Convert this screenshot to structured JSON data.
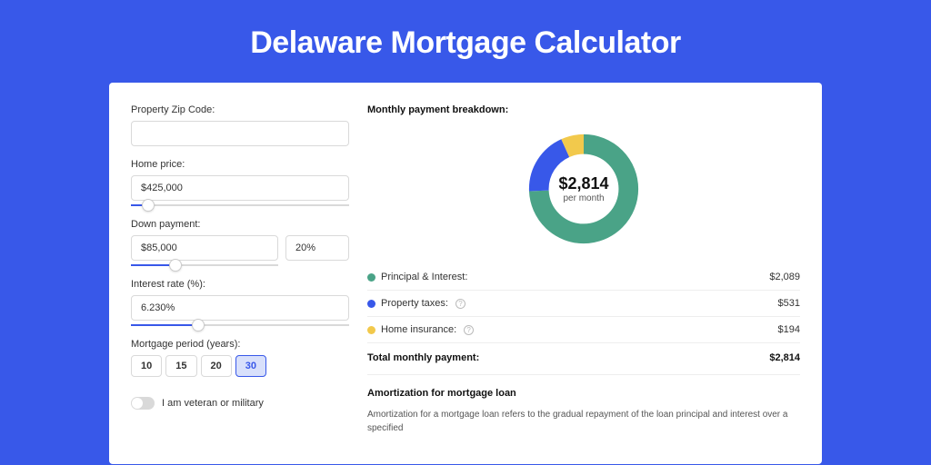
{
  "title": "Delaware Mortgage Calculator",
  "form": {
    "zip_label": "Property Zip Code:",
    "zip_value": "",
    "home_price_label": "Home price:",
    "home_price_value": "$425,000",
    "home_price_slider_pct": 8,
    "down_payment_label": "Down payment:",
    "down_payment_amount": "$85,000",
    "down_payment_pct": "20%",
    "down_payment_slider_pct": 20,
    "interest_label": "Interest rate (%):",
    "interest_value": "6.230%",
    "interest_slider_pct": 31,
    "period_label": "Mortgage period (years):",
    "period_options": [
      "10",
      "15",
      "20",
      "30"
    ],
    "period_active": "30",
    "veteran_label": "I am veteran or military",
    "veteran_on": false
  },
  "breakdown": {
    "title": "Monthly payment breakdown:",
    "total_display": "$2,814",
    "per_month_label": "per month",
    "items": [
      {
        "color": "green",
        "label": "Principal & Interest:",
        "value": "$2,089",
        "help": false
      },
      {
        "color": "blue",
        "label": "Property taxes:",
        "value": "$531",
        "help": true
      },
      {
        "color": "yellow",
        "label": "Home insurance:",
        "value": "$194",
        "help": true
      }
    ],
    "total_label": "Total monthly payment:",
    "total_value": "$2,814"
  },
  "chart_data": {
    "type": "pie",
    "title": "Monthly payment breakdown",
    "series": [
      {
        "name": "Principal & Interest",
        "value": 2089,
        "color": "#4aa387"
      },
      {
        "name": "Property taxes",
        "value": 531,
        "color": "#3858e9"
      },
      {
        "name": "Home insurance",
        "value": 194,
        "color": "#f2c94c"
      }
    ],
    "total": 2814,
    "center_label": "$2,814",
    "center_sublabel": "per month"
  },
  "amortization": {
    "title": "Amortization for mortgage loan",
    "body": "Amortization for a mortgage loan refers to the gradual repayment of the loan principal and interest over a specified"
  }
}
